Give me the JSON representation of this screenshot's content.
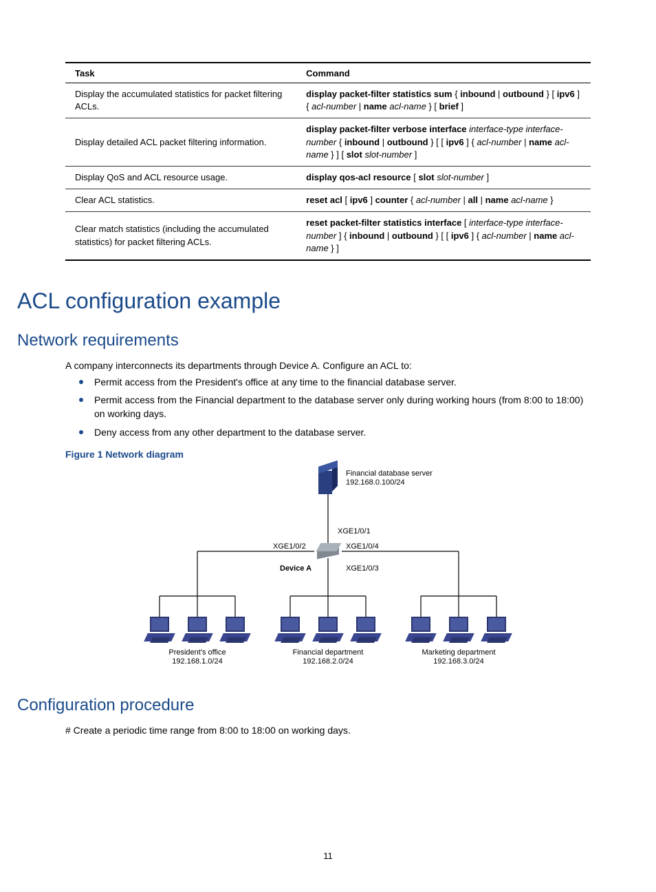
{
  "table": {
    "headers": [
      "Task",
      "Command"
    ],
    "rows": [
      {
        "task": "Display the accumulated statistics for packet filtering ACLs.",
        "cmd": [
          {
            "t": "display packet-filter statistics sum",
            "s": "b"
          },
          {
            "t": " { ",
            "s": ""
          },
          {
            "t": "inbound",
            "s": "b"
          },
          {
            "t": " | ",
            "s": ""
          },
          {
            "t": "outbound",
            "s": "b"
          },
          {
            "t": " } [ ",
            "s": ""
          },
          {
            "t": "ipv6",
            "s": "b"
          },
          {
            "t": " ] { ",
            "s": ""
          },
          {
            "t": "acl-number",
            "s": "i"
          },
          {
            "t": " | ",
            "s": ""
          },
          {
            "t": "name",
            "s": "b"
          },
          {
            "t": " ",
            "s": ""
          },
          {
            "t": "acl-name",
            "s": "i"
          },
          {
            "t": " } [ ",
            "s": ""
          },
          {
            "t": "brief",
            "s": "b"
          },
          {
            "t": " ]",
            "s": ""
          }
        ]
      },
      {
        "task": "Display detailed ACL packet filtering information.",
        "cmd": [
          {
            "t": "display packet-filter verbose  interface",
            "s": "b"
          },
          {
            "t": " ",
            "s": ""
          },
          {
            "t": "interface-type interface-number",
            "s": "i"
          },
          {
            "t": "  { ",
            "s": ""
          },
          {
            "t": "inbound",
            "s": "b"
          },
          {
            "t": " | ",
            "s": ""
          },
          {
            "t": "outbound",
            "s": "b"
          },
          {
            "t": " } [ [ ",
            "s": ""
          },
          {
            "t": "ipv6",
            "s": "b"
          },
          {
            "t": " ] { ",
            "s": ""
          },
          {
            "t": "acl-number",
            "s": "i"
          },
          {
            "t": " | ",
            "s": ""
          },
          {
            "t": "name",
            "s": "b"
          },
          {
            "t": " ",
            "s": ""
          },
          {
            "t": "acl-name",
            "s": "i"
          },
          {
            "t": " } ] [ ",
            "s": ""
          },
          {
            "t": "slot",
            "s": "b"
          },
          {
            "t": " ",
            "s": ""
          },
          {
            "t": "slot-number",
            "s": "i"
          },
          {
            "t": " ]",
            "s": ""
          }
        ]
      },
      {
        "task": "Display QoS and ACL resource usage.",
        "cmd": [
          {
            "t": "display qos-acl resource",
            "s": "b"
          },
          {
            "t": " [ ",
            "s": ""
          },
          {
            "t": "slot",
            "s": "b"
          },
          {
            "t": " ",
            "s": ""
          },
          {
            "t": "slot-number",
            "s": "i"
          },
          {
            "t": " ]",
            "s": ""
          }
        ]
      },
      {
        "task": "Clear ACL statistics.",
        "cmd": [
          {
            "t": "reset acl",
            "s": "b"
          },
          {
            "t": " [ ",
            "s": ""
          },
          {
            "t": "ipv6",
            "s": "b"
          },
          {
            "t": " ] ",
            "s": ""
          },
          {
            "t": "counter",
            "s": "b"
          },
          {
            "t": " { ",
            "s": ""
          },
          {
            "t": "acl-number",
            "s": "i"
          },
          {
            "t": " | ",
            "s": ""
          },
          {
            "t": "all",
            "s": "b"
          },
          {
            "t": " | ",
            "s": ""
          },
          {
            "t": "name",
            "s": "b"
          },
          {
            "t": " ",
            "s": ""
          },
          {
            "t": "acl-name",
            "s": "i"
          },
          {
            "t": " }",
            "s": ""
          }
        ]
      },
      {
        "task": "Clear match statistics (including the accumulated statistics) for packet filtering ACLs.",
        "cmd": [
          {
            "t": "reset packet-filter statistics  interface",
            "s": "b"
          },
          {
            "t": " [ ",
            "s": ""
          },
          {
            "t": "interface-type interface-number",
            "s": "i"
          },
          {
            "t": " ] { ",
            "s": ""
          },
          {
            "t": "inbound",
            "s": "b"
          },
          {
            "t": " | ",
            "s": ""
          },
          {
            "t": "outbound",
            "s": "b"
          },
          {
            "t": " } [ [ ",
            "s": ""
          },
          {
            "t": "ipv6",
            "s": "b"
          },
          {
            "t": " ] { ",
            "s": ""
          },
          {
            "t": "acl-number",
            "s": "i"
          },
          {
            "t": " | ",
            "s": ""
          },
          {
            "t": "name",
            "s": "b"
          },
          {
            "t": " ",
            "s": ""
          },
          {
            "t": "acl-name",
            "s": "i"
          },
          {
            "t": " } ]",
            "s": ""
          }
        ]
      }
    ]
  },
  "h1": "ACL configuration example",
  "h2a": "Network requirements",
  "intro": "A company interconnects its departments through Device A. Configure an ACL to:",
  "bullets": [
    "Permit access from the President's office at any time to the financial database server.",
    "Permit access from the Financial department to the database server only during working hours (from 8:00 to 18:00) on working days.",
    "Deny access from any other department to the database server."
  ],
  "figcap": "Figure 1 Network diagram",
  "diagram": {
    "server_label": "Financial database server",
    "server_ip": "192.168.0.100/24",
    "ports": {
      "p1": "XGE1/0/1",
      "p2": "XGE1/0/2",
      "p3": "XGE1/0/3",
      "p4": "XGE1/0/4"
    },
    "device": "Device A",
    "groups": [
      {
        "name": "President's office",
        "ip": "192.168.1.0/24"
      },
      {
        "name": "Financial department",
        "ip": "192.168.2.0/24"
      },
      {
        "name": "Marketing department",
        "ip": "192.168.3.0/24"
      }
    ]
  },
  "h2b": "Configuration procedure",
  "proc_line": "# Create a periodic time range from 8:00 to 18:00 on working days.",
  "page_number": "11"
}
